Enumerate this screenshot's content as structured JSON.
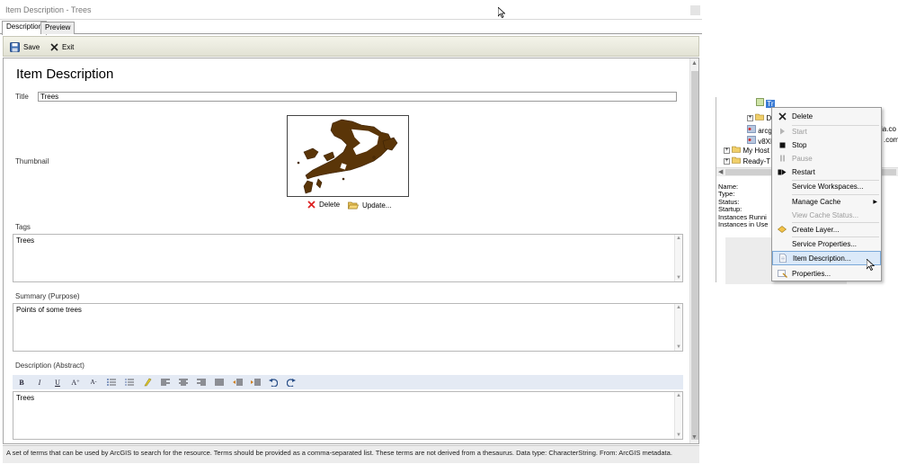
{
  "window": {
    "title": "Item Description - Trees"
  },
  "tabs": [
    {
      "label": "Description"
    },
    {
      "label": "Preview"
    }
  ],
  "toolbar": {
    "save_label": "Save",
    "exit_label": "Exit"
  },
  "form": {
    "heading": "Item Description",
    "title_label": "Title",
    "title_value": "Trees",
    "thumbnail_label": "Thumbnail",
    "thumb_delete_label": "Delete",
    "thumb_update_label": "Update...",
    "tags_label": "Tags",
    "tags_value": "Trees",
    "summary_label": "Summary (Purpose)",
    "summary_value": "Points of some trees",
    "description_label": "Description (Abstract)",
    "description_value": "Trees"
  },
  "format_toolbar": {
    "bold": "B",
    "italic": "I",
    "underline": "U",
    "grow": "A",
    "shrink": "A",
    "grow_sup": "+",
    "shrink_sup": "-"
  },
  "help_text": "A set of terms that can be used by ArcGIS to search for the resource. Terms should be provided as a comma-separated list. These terms are not derived from a thesaurus. Data type: CharacterString. From: ArcGIS metadata.",
  "tree": {
    "rows": [
      "Tr",
      "D",
      "arcg",
      "v8XB",
      "My Host",
      "Ready-T",
      "Tr",
      "ia.co",
      ".com"
    ]
  },
  "props": {
    "name": "Name:",
    "type": "Type:",
    "status": "Status:",
    "startup": "Startup:",
    "running": "Instances Runni",
    "in_use": "Instances in Use"
  },
  "context_menu": {
    "items": [
      "Delete",
      "Start",
      "Stop",
      "Pause",
      "Restart",
      "Service Workspaces...",
      "Manage Cache",
      "View Cache Status...",
      "Create Layer...",
      "Service Properties...",
      "Item Description...",
      "Properties..."
    ],
    "submenu_arrow": "▶"
  },
  "colors": {
    "accent": "#dbe9f9",
    "thumbnail_fill": "#5a3508"
  }
}
